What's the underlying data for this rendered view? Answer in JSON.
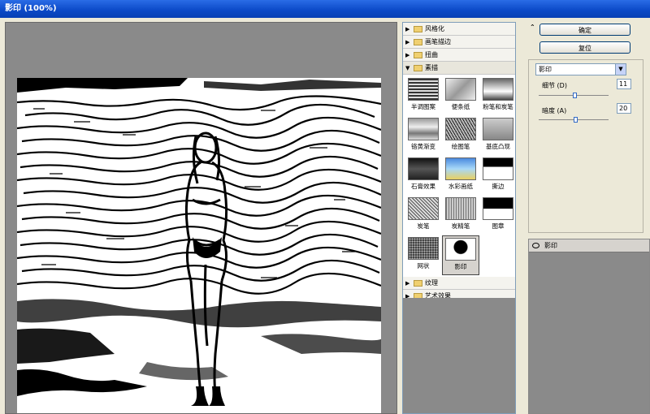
{
  "window": {
    "title": "影印 (100%)"
  },
  "gallery": {
    "categories_top": [
      {
        "label": "风格化",
        "expanded": false
      },
      {
        "label": "画笔描边",
        "expanded": false
      },
      {
        "label": "扭曲",
        "expanded": false
      },
      {
        "label": "素描",
        "expanded": true
      }
    ],
    "filters": [
      {
        "label": "半调图案"
      },
      {
        "label": "便条纸"
      },
      {
        "label": "粉笔和炭笔"
      },
      {
        "label": "铬黄渐变"
      },
      {
        "label": "绘图笔"
      },
      {
        "label": "基底凸现"
      },
      {
        "label": "石膏效果"
      },
      {
        "label": "水彩画纸"
      },
      {
        "label": "撕边"
      },
      {
        "label": "炭笔"
      },
      {
        "label": "炭精笔"
      },
      {
        "label": "图章"
      },
      {
        "label": "网状"
      },
      {
        "label": "影印",
        "selected": true
      }
    ],
    "categories_bottom": [
      {
        "label": "纹理",
        "expanded": false
      },
      {
        "label": "艺术效果",
        "expanded": false
      }
    ]
  },
  "controls": {
    "ok_label": "确定",
    "reset_label": "复位",
    "collapse_icon": "double-chevron-up-icon",
    "filter_select": "影印",
    "params": [
      {
        "label": "细节 (D)",
        "value": "11",
        "slider_fraction": 0.45
      },
      {
        "label": "暗度 (A)",
        "value": "20",
        "slider_fraction": 0.46
      }
    ],
    "layer_label": "影印"
  },
  "colors": {
    "accent": "#0a48c6",
    "panel_gray": "#8a8a8a"
  }
}
